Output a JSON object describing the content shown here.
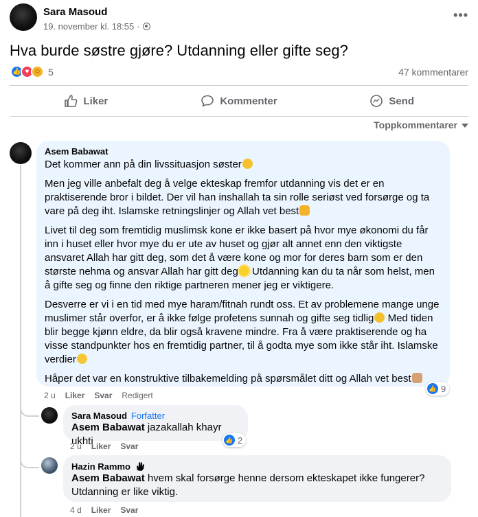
{
  "post": {
    "author": "Sara Masoud",
    "timestamp": "19. november kl. 18:55",
    "text": "Hva burde søstre gjøre? Utdanning eller gifte seg?",
    "reaction_count": "5",
    "comments_count": "47 kommentarer",
    "more_label": "•••"
  },
  "actions": {
    "like": "Liker",
    "comment": "Kommenter",
    "send": "Send"
  },
  "sort_label": "Toppkommentarer",
  "comment": {
    "author": "Asem Babawat",
    "paragraphs": [
      "Det kommer ann på din livssituasjon søster",
      "Men jeg ville anbefalt deg å velge ekteskap fremfor utdanning vis det er en praktiserende bror i bildet. Der vil han inshallah ta sin rolle seriøst ved forsørge og ta vare på deg iht. Islamske retningslinjer og Allah vet best",
      "Livet til deg som fremtidig muslimsk kone er ikke basert på hvor mye økonomi du får inn i huset eller hvor mye du er ute av huset og gjør alt annet enn den viktigste ansvaret Allah har gitt deg, som det å være kone og mor for deres barn som er den største nehma og ansvar Allah har gitt deg",
      " Utdanning kan du ta når som helst, men å gifte seg og finne den riktige partneren mener jeg er viktigere.",
      "Desverre er vi i en tid med mye haram/fitnah rundt oss. Et av problemene mange unge muslimer står overfor, er å ikke følge profetens sunnah og gifte seg tidlig",
      " Med tiden blir begge kjønn eldre, da blir også kravene mindre. Fra å være praktiserende og ha visse standpunkter hos en fremtidig partner, til å godta mye som ikke står iht. Islamske verdier",
      "Håper det var en konstruktive tilbakemelding på spørsmålet ditt og Allah vet best"
    ],
    "time": "2 u",
    "like": "Liker",
    "reply": "Svar",
    "edited": "Redigert",
    "reaction_count": "9"
  },
  "replies": [
    {
      "author": "Sara Masoud",
      "badge": "Forfatter",
      "mention": "Asem Babawat",
      "text": " jazakallah khayr ukhti",
      "time": "2 u",
      "like": "Liker",
      "reply": "Svar",
      "reaction_count": "2"
    },
    {
      "author": "Hazin Rammo",
      "mention": "Asem Babawat",
      "text": " hvem skal forsørge henne dersom ekteskapet ikke fungerer? Utdanning er like viktig.",
      "time": "4 d",
      "like": "Liker",
      "reply": "Svar"
    }
  ],
  "colors": {
    "accent": "#1877f2",
    "secondary_text": "#65676b",
    "bubble": "#f0f2f5",
    "highlighted_bubble": "#ebf5ff"
  },
  "icons": {
    "globe": "globe-icon",
    "like": "thumbs-up-icon",
    "comment": "speech-bubble-icon",
    "send": "messenger-icon"
  }
}
